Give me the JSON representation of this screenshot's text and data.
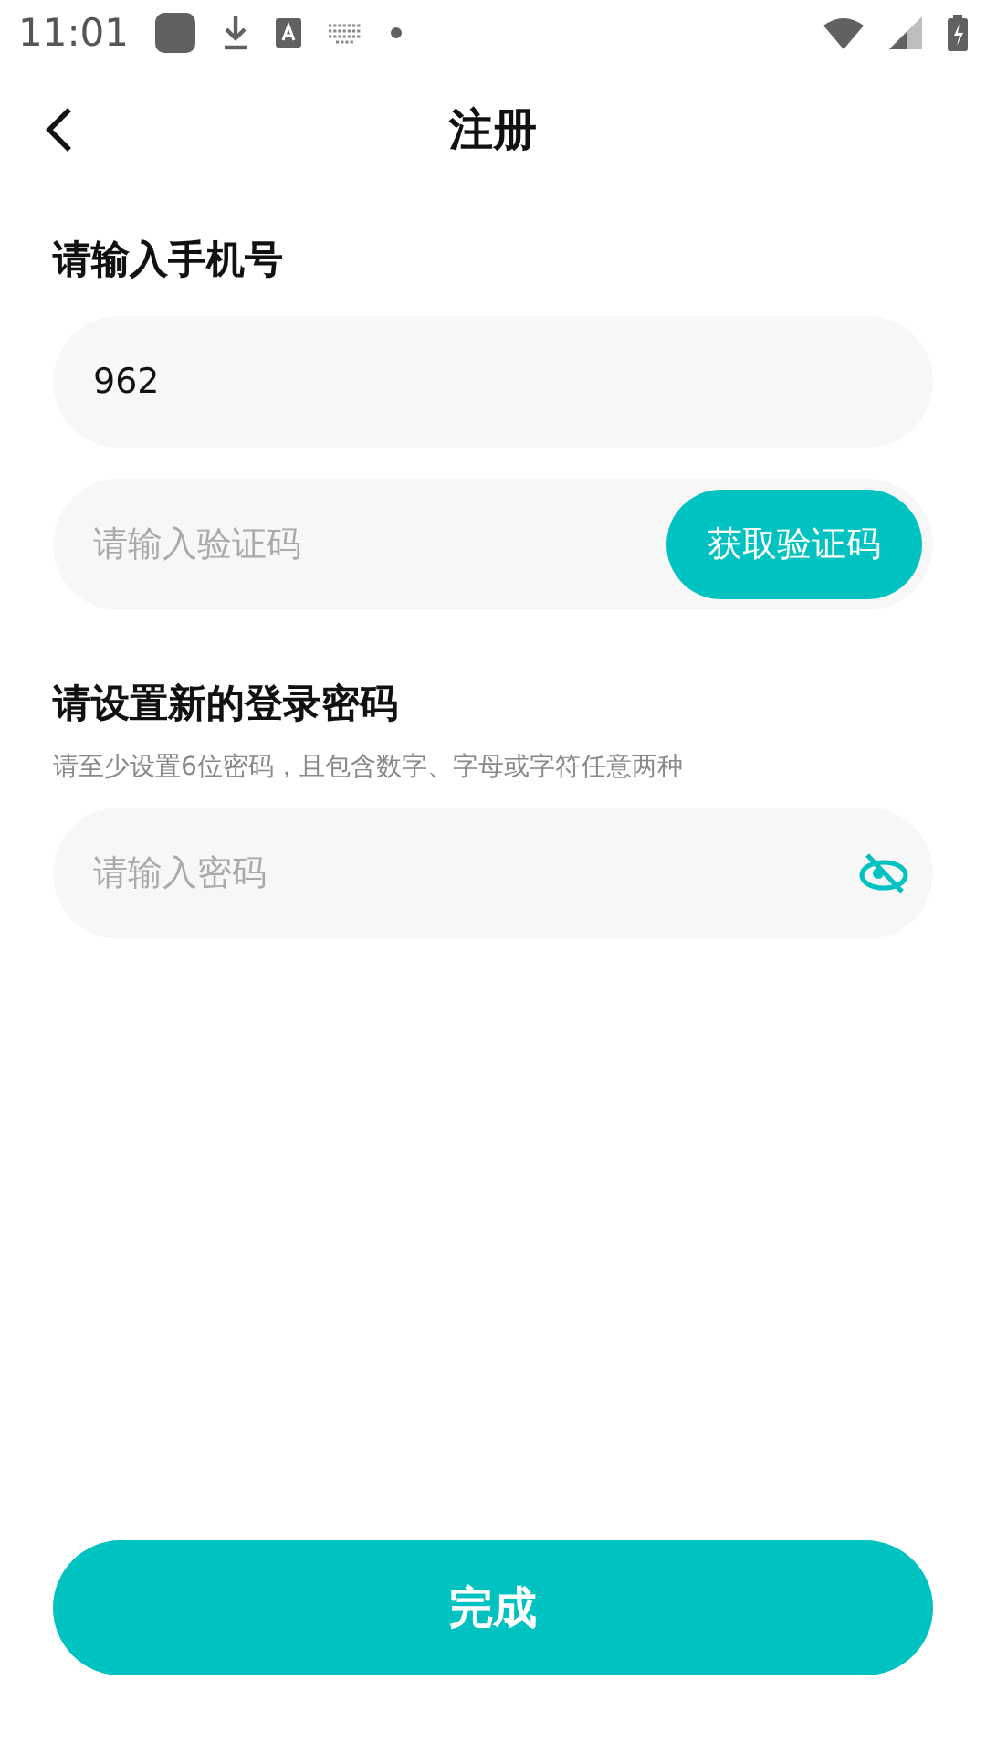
{
  "status_bar": {
    "time": "11:01"
  },
  "header": {
    "title": "注册"
  },
  "phone": {
    "label": "请输入手机号",
    "value": "962"
  },
  "code": {
    "placeholder": "请输入验证码",
    "button": "获取验证码"
  },
  "password": {
    "label": "请设置新的登录密码",
    "hint": "请至少设置6位密码，且包含数字、字母或字符任意两种",
    "placeholder": "请输入密码",
    "visible": false
  },
  "submit": "完成"
}
